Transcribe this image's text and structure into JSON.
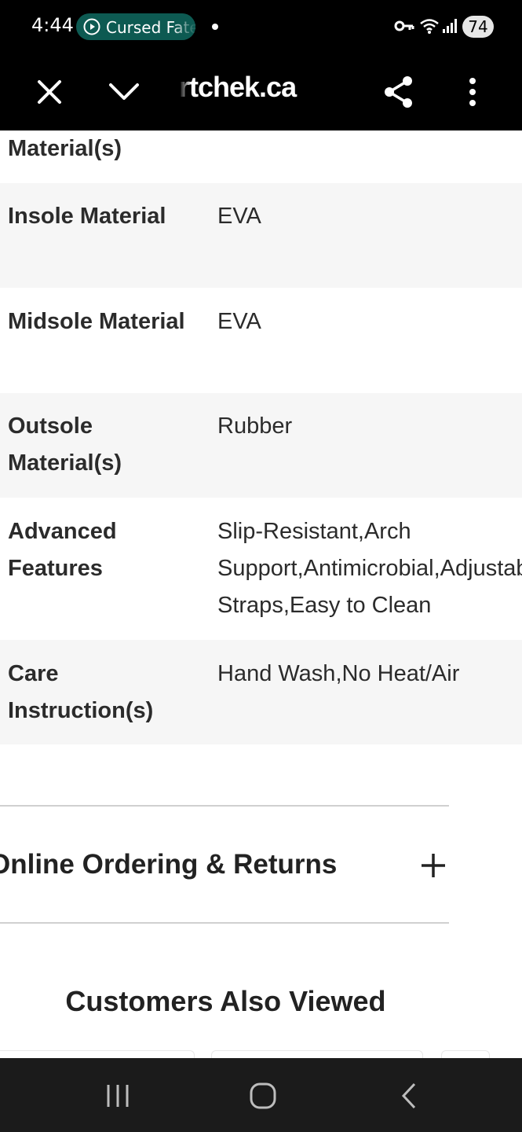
{
  "status_bar": {
    "time": "4:44",
    "media_title": "Cursed Fate",
    "battery": "74"
  },
  "browser": {
    "url": "rtchek.ca",
    "icons": [
      "close-icon",
      "chevron-down-icon",
      "share-icon",
      "more-vert-icon"
    ]
  },
  "specs": {
    "partial_label": "Material(s)",
    "rows": [
      {
        "label": "Insole Material",
        "value": "EVA"
      },
      {
        "label": "Midsole Material",
        "value": "EVA"
      },
      {
        "label": "Outsole Material(s)",
        "value": "Rubber"
      },
      {
        "label": "Advanced Features",
        "value": "Slip-Resistant,Arch Support,Antimicrobial,Adjustable Straps,Easy to Clean"
      },
      {
        "label": "Care Instruction(s)",
        "value": "Hand Wash,No Heat/Air"
      }
    ]
  },
  "accordion": {
    "title": "Online Ordering & Returns"
  },
  "section": {
    "customers_also_viewed": "Customers Also Viewed"
  },
  "nav_bar": {
    "icons": [
      "recents-icon",
      "home-icon",
      "back-icon"
    ]
  },
  "colors": {
    "status_bg": "#000000",
    "pill": "#0d5a52",
    "row_shade": "#f6f6f6",
    "nav_bg": "#1b1b1b"
  }
}
